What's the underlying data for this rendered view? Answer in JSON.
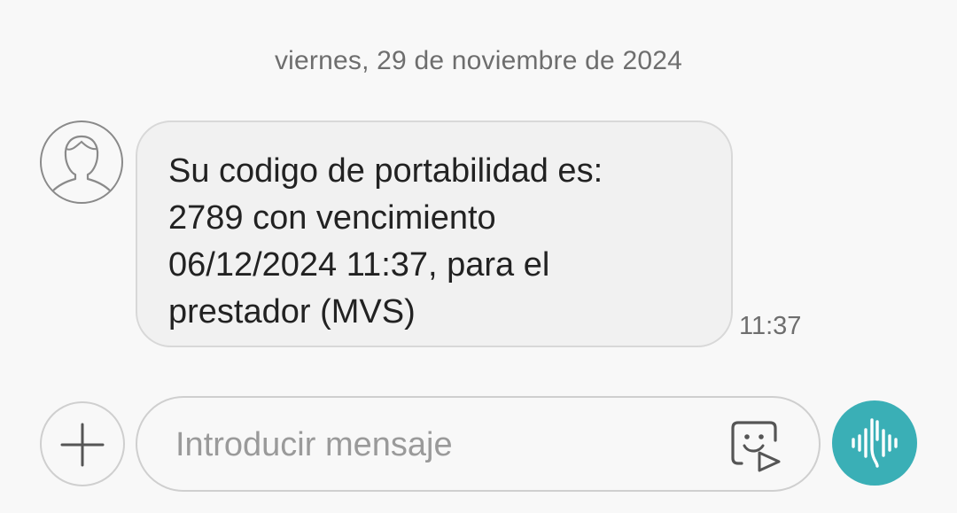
{
  "conversation": {
    "date_separator": "viernes, 29 de noviembre de 2024",
    "messages": [
      {
        "direction": "incoming",
        "text": "Su codigo de portabilidad es: 2789 con vencimiento 06/12/2024 11:37, para el prestador (MVS)",
        "time": "11:37",
        "avatar_icon": "contact-silhouette-icon"
      }
    ]
  },
  "composer": {
    "add_icon": "plus-icon",
    "placeholder": "Introducir mensaje",
    "value": "",
    "sticker_icon": "sticker-icon",
    "voice_icon": "voice-waveform-icon"
  },
  "colors": {
    "background": "#f8f8f8",
    "bubble_fill": "#f1f1f1",
    "bubble_border": "#d8d8d8",
    "accent": "#3aafb6",
    "secondary_text": "#6e6e6e"
  }
}
